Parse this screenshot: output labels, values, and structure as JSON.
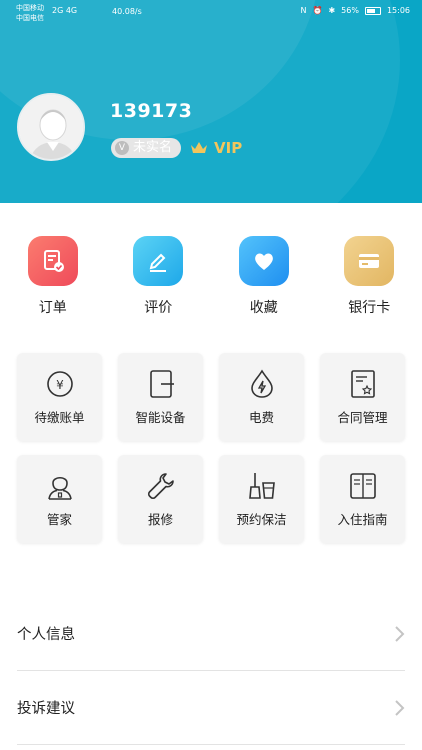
{
  "status_bar": {
    "carrier1": "中国移动",
    "carrier2": "中国电信",
    "signal": "2G 4G",
    "network_speed": "40.08/s",
    "battery": "56%",
    "time": "15:06"
  },
  "profile": {
    "username": "139173",
    "verify_status": "未实名",
    "vip_label": "VIP"
  },
  "quick_actions": [
    {
      "label": "订单",
      "icon": "order-icon",
      "color": "#f25e60"
    },
    {
      "label": "评价",
      "icon": "edit-icon",
      "color": "#29b5ee"
    },
    {
      "label": "收藏",
      "icon": "heart-icon",
      "color": "#2aa8f2"
    },
    {
      "label": "银行卡",
      "icon": "card-icon",
      "color": "#e9c372"
    }
  ],
  "services": [
    {
      "label": "待缴账单",
      "icon": "yen-bill-icon"
    },
    {
      "label": "智能设备",
      "icon": "smart-device-icon"
    },
    {
      "label": "电费",
      "icon": "electricity-icon"
    },
    {
      "label": "合同管理",
      "icon": "contract-icon"
    },
    {
      "label": "管家",
      "icon": "housekeeper-icon"
    },
    {
      "label": "报修",
      "icon": "wrench-icon"
    },
    {
      "label": "预约保洁",
      "icon": "cleaning-icon"
    },
    {
      "label": "入住指南",
      "icon": "guide-book-icon"
    }
  ],
  "menu": [
    {
      "label": "个人信息"
    },
    {
      "label": "投诉建议"
    }
  ],
  "colors": {
    "header_bg": "#0aa6c6",
    "vip_gold": "#f2c55c"
  }
}
